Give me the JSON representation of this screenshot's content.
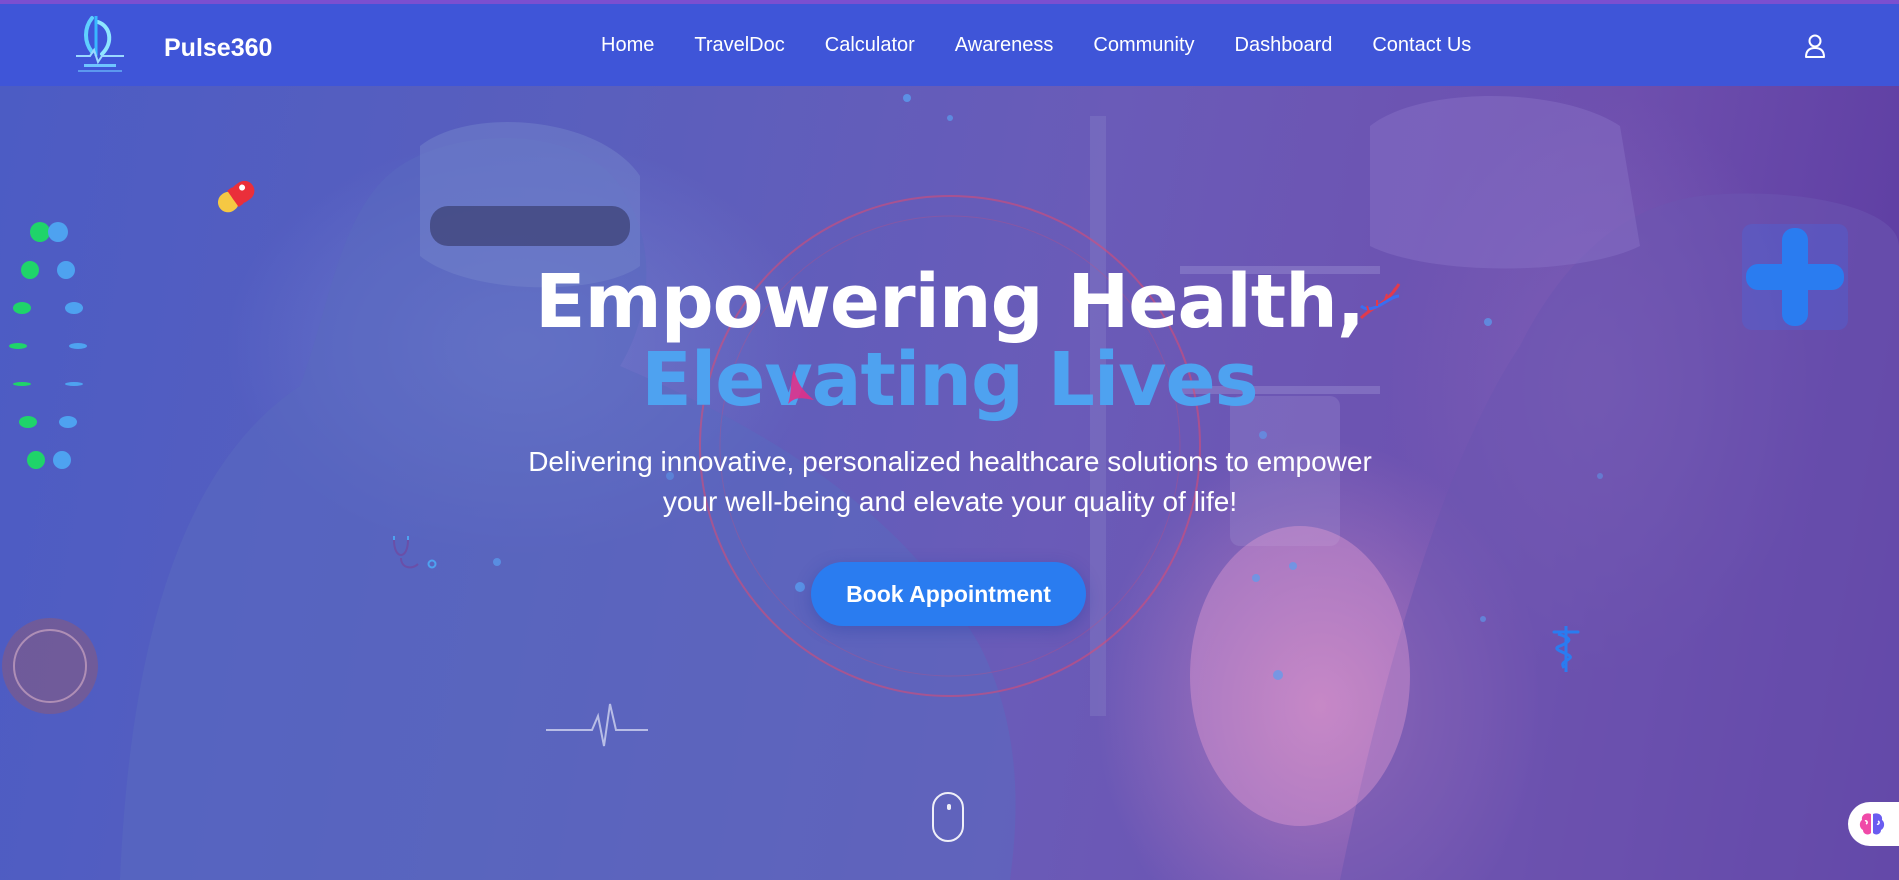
{
  "brand": {
    "name": "Pulse360",
    "logo_icon": "pulse360-logo-icon"
  },
  "nav": {
    "links": [
      "Home",
      "TravelDoc",
      "Calculator",
      "Awareness",
      "Community",
      "Dashboard",
      "Contact Us"
    ],
    "user_icon": "user-icon"
  },
  "hero": {
    "title_line1": "Empowering Health,",
    "title_line2": "Elevating Lives",
    "subtitle_line1": "Delivering innovative, personalized healthcare solutions to empower",
    "subtitle_line2": "your well-being and elevate your quality of life!",
    "cta_label": "Book Appointment",
    "scroll_icon": "mouse-scroll-icon"
  },
  "decorations": [
    "pill-icon",
    "dna-icon",
    "medical-cross-icon",
    "caduceus-icon",
    "stethoscope-icon",
    "heartbeat-line-icon",
    "dna-dots-icon"
  ],
  "widget": {
    "icon": "brain-icon"
  },
  "colors": {
    "navbar": "#3f55d8",
    "accent_blue": "#2a7cf0",
    "title_highlight": "#4ea2f0",
    "green_dot": "#1fd46a"
  }
}
